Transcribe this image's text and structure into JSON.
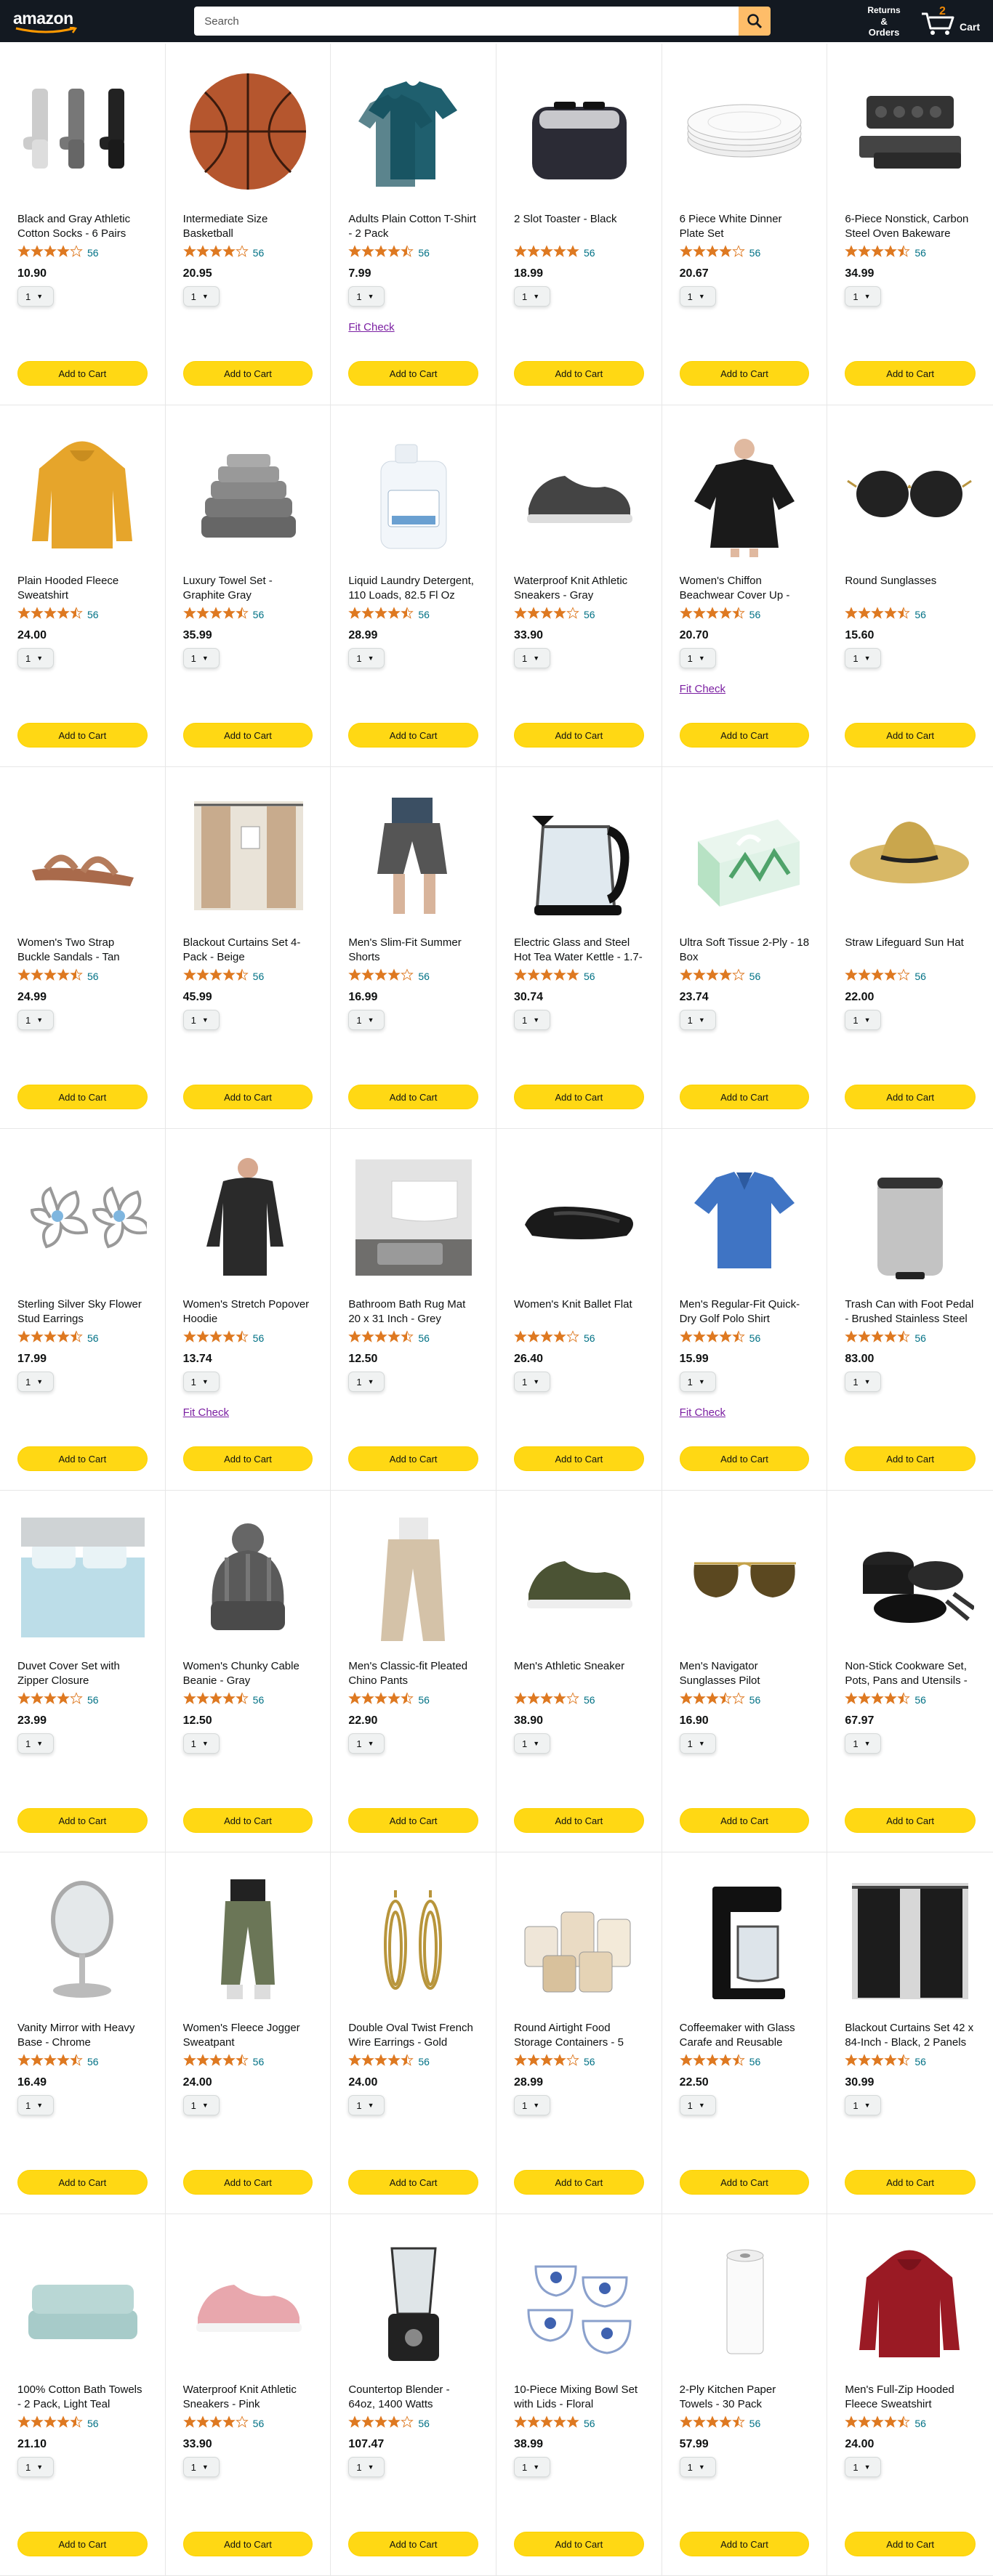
{
  "header": {
    "logo_text": "amazon",
    "search_placeholder": "Search",
    "returns_line1": "Returns",
    "returns_line2": "& Orders",
    "cart_count": "2",
    "cart_label": "Cart"
  },
  "colors": {
    "header_bg": "#131921",
    "search_btn": "#febd69",
    "add_btn": "#ffd814",
    "star": "#de7921",
    "link": "#007185",
    "fit_link": "#7b1fa2"
  },
  "products": [
    {
      "title": "Black and Gray Athletic Cotton Socks - 6 Pairs",
      "rating": 4,
      "reviews": "56",
      "price": "10.90",
      "qty": "1",
      "fit": "",
      "button": "Add to Cart",
      "icon": "socks-icon"
    },
    {
      "title": "Intermediate Size Basketball",
      "rating": 4,
      "reviews": "56",
      "price": "20.95",
      "qty": "1",
      "fit": "",
      "button": "Add to Cart",
      "icon": "basketball-icon"
    },
    {
      "title": "Adults Plain Cotton T-Shirt - 2 Pack",
      "rating": 4.5,
      "reviews": "56",
      "price": "7.99",
      "qty": "1",
      "fit": "Fit Check",
      "button": "Add to Cart",
      "icon": "tshirt-icon"
    },
    {
      "title": "2 Slot Toaster - Black",
      "rating": 5,
      "reviews": "56",
      "price": "18.99",
      "qty": "1",
      "fit": "",
      "button": "Add to Cart",
      "icon": "toaster-icon"
    },
    {
      "title": "6 Piece White Dinner Plate Set",
      "rating": 4,
      "reviews": "56",
      "price": "20.67",
      "qty": "1",
      "fit": "",
      "button": "Add to Cart",
      "icon": "plates-icon"
    },
    {
      "title": "6-Piece Nonstick, Carbon Steel Oven Bakeware Baking Set",
      "rating": 4.5,
      "reviews": "56",
      "price": "34.99",
      "qty": "1",
      "fit": "",
      "button": "Add to Cart",
      "icon": "bakeware-icon"
    },
    {
      "title": "Plain Hooded Fleece Sweatshirt",
      "rating": 4.5,
      "reviews": "56",
      "price": "24.00",
      "qty": "1",
      "fit": "",
      "button": "Add to Cart",
      "icon": "hoodie-yellow-icon"
    },
    {
      "title": "Luxury Towel Set - Graphite Gray",
      "rating": 4.5,
      "reviews": "56",
      "price": "35.99",
      "qty": "1",
      "fit": "",
      "button": "Add to Cart",
      "icon": "towels-gray-icon"
    },
    {
      "title": "Liquid Laundry Detergent, 110 Loads, 82.5 Fl Oz",
      "rating": 4.5,
      "reviews": "56",
      "price": "28.99",
      "qty": "1",
      "fit": "",
      "button": "Add to Cart",
      "icon": "detergent-icon"
    },
    {
      "title": "Waterproof Knit Athletic Sneakers - Gray",
      "rating": 4,
      "reviews": "56",
      "price": "33.90",
      "qty": "1",
      "fit": "",
      "button": "Add to Cart",
      "icon": "sneaker-gray-icon"
    },
    {
      "title": "Women's Chiffon Beachwear Cover Up - Black",
      "rating": 4.5,
      "reviews": "56",
      "price": "20.70",
      "qty": "1",
      "fit": "Fit Check",
      "button": "Add to Cart",
      "icon": "coverup-icon"
    },
    {
      "title": "Round Sunglasses",
      "rating": 4.5,
      "reviews": "56",
      "price": "15.60",
      "qty": "1",
      "fit": "",
      "button": "Add to Cart",
      "icon": "round-sunglasses-icon"
    },
    {
      "title": "Women's Two Strap Buckle Sandals - Tan",
      "rating": 4.5,
      "reviews": "56",
      "price": "24.99",
      "qty": "1",
      "fit": "",
      "button": "Add to Cart",
      "icon": "sandals-icon"
    },
    {
      "title": "Blackout Curtains Set 4-Pack - Beige",
      "rating": 4.5,
      "reviews": "56",
      "price": "45.99",
      "qty": "1",
      "fit": "",
      "button": "Add to Cart",
      "icon": "curtains-beige-icon"
    },
    {
      "title": "Men's Slim-Fit Summer Shorts",
      "rating": 4,
      "reviews": "56",
      "price": "16.99",
      "qty": "1",
      "fit": "",
      "button": "Add to Cart",
      "icon": "shorts-icon"
    },
    {
      "title": "Electric Glass and Steel Hot Tea Water Kettle - 1.7-Liter",
      "rating": 5,
      "reviews": "56",
      "price": "30.74",
      "qty": "1",
      "fit": "",
      "button": "Add to Cart",
      "icon": "kettle-icon"
    },
    {
      "title": "Ultra Soft Tissue 2-Ply - 18 Box",
      "rating": 4,
      "reviews": "56",
      "price": "23.74",
      "qty": "1",
      "fit": "",
      "button": "Add to Cart",
      "icon": "tissue-box-icon"
    },
    {
      "title": "Straw Lifeguard Sun Hat",
      "rating": 4,
      "reviews": "56",
      "price": "22.00",
      "qty": "1",
      "fit": "",
      "button": "Add to Cart",
      "icon": "straw-hat-icon"
    },
    {
      "title": "Sterling Silver Sky Flower Stud Earrings",
      "rating": 4.5,
      "reviews": "56",
      "price": "17.99",
      "qty": "1",
      "fit": "",
      "button": "Add to Cart",
      "icon": "flower-earrings-icon"
    },
    {
      "title": "Women's Stretch Popover Hoodie",
      "rating": 4.5,
      "reviews": "56",
      "price": "13.74",
      "qty": "1",
      "fit": "Fit Check",
      "button": "Add to Cart",
      "icon": "popover-hoodie-icon"
    },
    {
      "title": "Bathroom Bath Rug Mat 20 x 31 Inch - Grey",
      "rating": 4.5,
      "reviews": "56",
      "price": "12.50",
      "qty": "1",
      "fit": "",
      "button": "Add to Cart",
      "icon": "bath-mat-icon"
    },
    {
      "title": "Women's Knit Ballet Flat",
      "rating": 4,
      "reviews": "56",
      "price": "26.40",
      "qty": "1",
      "fit": "",
      "button": "Add to Cart",
      "icon": "ballet-flat-icon"
    },
    {
      "title": "Men's Regular-Fit Quick-Dry Golf Polo Shirt",
      "rating": 4.5,
      "reviews": "56",
      "price": "15.99",
      "qty": "1",
      "fit": "Fit Check",
      "button": "Add to Cart",
      "icon": "polo-shirt-icon"
    },
    {
      "title": "Trash Can with Foot Pedal - Brushed Stainless Steel",
      "rating": 4.5,
      "reviews": "56",
      "price": "83.00",
      "qty": "1",
      "fit": "",
      "button": "Add to Cart",
      "icon": "trash-can-icon"
    },
    {
      "title": "Duvet Cover Set with Zipper Closure",
      "rating": 4,
      "reviews": "56",
      "price": "23.99",
      "qty": "1",
      "fit": "",
      "button": "Add to Cart",
      "icon": "duvet-icon"
    },
    {
      "title": "Women's Chunky Cable Beanie - Gray",
      "rating": 4.5,
      "reviews": "56",
      "price": "12.50",
      "qty": "1",
      "fit": "",
      "button": "Add to Cart",
      "icon": "beanie-icon"
    },
    {
      "title": "Men's Classic-fit Pleated Chino Pants",
      "rating": 4.5,
      "reviews": "56",
      "price": "22.90",
      "qty": "1",
      "fit": "",
      "button": "Add to Cart",
      "icon": "chino-pants-icon"
    },
    {
      "title": "Men's Athletic Sneaker",
      "rating": 4,
      "reviews": "56",
      "price": "38.90",
      "qty": "1",
      "fit": "",
      "button": "Add to Cart",
      "icon": "sneaker-olive-icon"
    },
    {
      "title": "Men's Navigator Sunglasses Pilot",
      "rating": 3.5,
      "reviews": "56",
      "price": "16.90",
      "qty": "1",
      "fit": "",
      "button": "Add to Cart",
      "icon": "aviator-sunglasses-icon"
    },
    {
      "title": "Non-Stick Cookware Set, Pots, Pans and Utensils - 15 Pieces",
      "rating": 4.5,
      "reviews": "56",
      "price": "67.97",
      "qty": "1",
      "fit": "",
      "button": "Add to Cart",
      "icon": "cookware-icon"
    },
    {
      "title": "Vanity Mirror with Heavy Base - Chrome",
      "rating": 4.5,
      "reviews": "56",
      "price": "16.49",
      "qty": "1",
      "fit": "",
      "button": "Add to Cart",
      "icon": "vanity-mirror-icon"
    },
    {
      "title": "Women's Fleece Jogger Sweatpant",
      "rating": 4.5,
      "reviews": "56",
      "price": "24.00",
      "qty": "1",
      "fit": "",
      "button": "Add to Cart",
      "icon": "joggers-icon"
    },
    {
      "title": "Double Oval Twist French Wire Earrings - Gold",
      "rating": 4.5,
      "reviews": "56",
      "price": "24.00",
      "qty": "1",
      "fit": "",
      "button": "Add to Cart",
      "icon": "gold-earrings-icon"
    },
    {
      "title": "Round Airtight Food Storage Containers - 5 Piece",
      "rating": 4,
      "reviews": "56",
      "price": "28.99",
      "qty": "1",
      "fit": "",
      "button": "Add to Cart",
      "icon": "food-containers-icon"
    },
    {
      "title": "Coffeemaker with Glass Carafe and Reusable Filter - 25 Oz",
      "rating": 4.5,
      "reviews": "56",
      "price": "22.50",
      "qty": "1",
      "fit": "",
      "button": "Add to Cart",
      "icon": "coffeemaker-icon"
    },
    {
      "title": "Blackout Curtains Set 42 x 84-Inch - Black, 2 Panels",
      "rating": 4.5,
      "reviews": "56",
      "price": "30.99",
      "qty": "1",
      "fit": "",
      "button": "Add to Cart",
      "icon": "curtains-black-icon"
    },
    {
      "title": "100% Cotton Bath Towels - 2 Pack, Light Teal",
      "rating": 4.5,
      "reviews": "56",
      "price": "21.10",
      "qty": "1",
      "fit": "",
      "button": "Add to Cart",
      "icon": "towels-teal-icon"
    },
    {
      "title": "Waterproof Knit Athletic Sneakers - Pink",
      "rating": 4,
      "reviews": "56",
      "price": "33.90",
      "qty": "1",
      "fit": "",
      "button": "Add to Cart",
      "icon": "sneaker-pink-icon"
    },
    {
      "title": "Countertop Blender - 64oz, 1400 Watts",
      "rating": 4,
      "reviews": "56",
      "price": "107.47",
      "qty": "1",
      "fit": "",
      "button": "Add to Cart",
      "icon": "blender-icon"
    },
    {
      "title": "10-Piece Mixing Bowl Set with Lids - Floral",
      "rating": 5,
      "reviews": "56",
      "price": "38.99",
      "qty": "1",
      "fit": "",
      "button": "Add to Cart",
      "icon": "mixing-bowls-icon"
    },
    {
      "title": "2-Ply Kitchen Paper Towels - 30 Pack",
      "rating": 4.5,
      "reviews": "56",
      "price": "57.99",
      "qty": "1",
      "fit": "",
      "button": "Add to Cart",
      "icon": "paper-towel-icon"
    },
    {
      "title": "Men's Full-Zip Hooded Fleece Sweatshirt",
      "rating": 4.5,
      "reviews": "56",
      "price": "24.00",
      "qty": "1",
      "fit": "",
      "button": "Add to Cart",
      "icon": "hoodie-red-icon"
    }
  ]
}
